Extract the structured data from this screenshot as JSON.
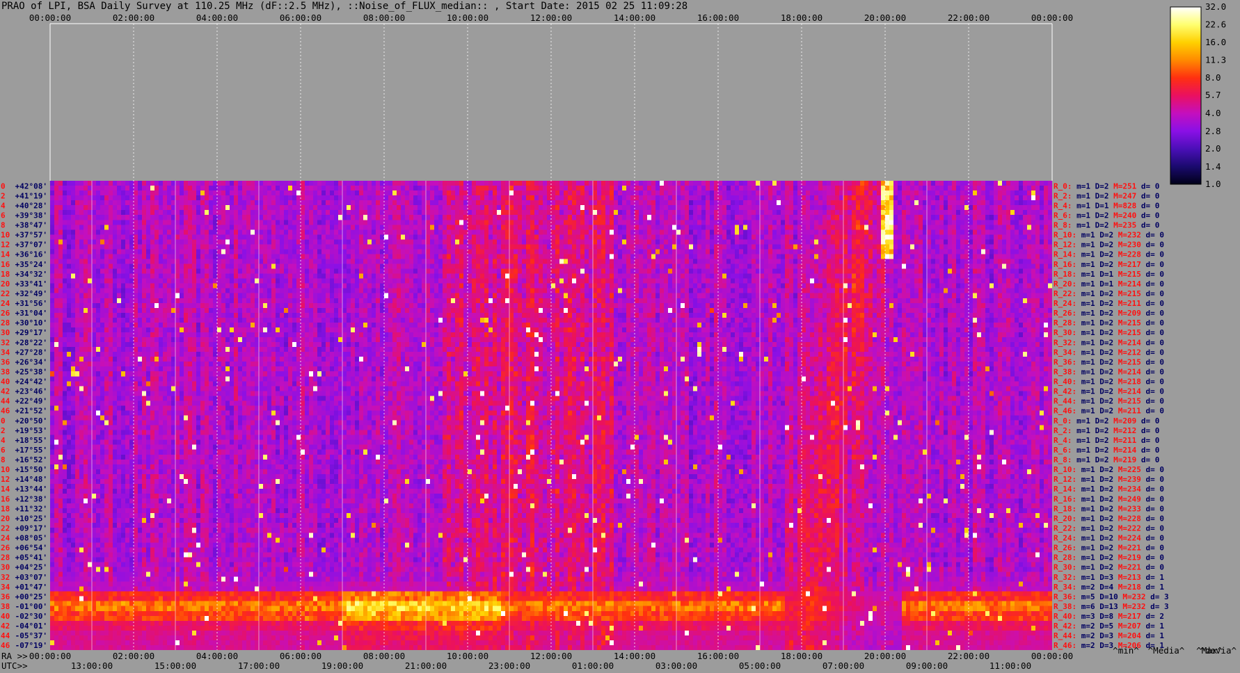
{
  "header": {
    "title": "PRAO of LPI, BSA Daily Survey at 110.25 MHz (dF::2.5 MHz), ::Noise_of_FLUX_median:: , Start Date: 2015 02 25 11:09:28"
  },
  "chart_data": {
    "type": "heatmap",
    "top_axis_ticks": [
      "00:00:00",
      "02:00:00",
      "04:00:00",
      "06:00:00",
      "08:00:00",
      "10:00:00",
      "12:00:00",
      "14:00:00",
      "16:00:00",
      "18:00:00",
      "20:00:00",
      "22:00:00",
      "00:00:00"
    ],
    "ra_axis_prefix": "RA >>",
    "ra_axis_ticks": [
      "00:00:00",
      "02:00:00",
      "04:00:00",
      "06:00:00",
      "08:00:00",
      "10:00:00",
      "12:00:00",
      "14:00:00",
      "16:00:00",
      "18:00:00",
      "20:00:00",
      "22:00:00",
      "00:00:00"
    ],
    "utc_axis_prefix": "UTC>>",
    "utc_axis_ticks": [
      "13:00:00",
      "15:00:00",
      "17:00:00",
      "19:00:00",
      "21:00:00",
      "23:00:00",
      "01:00:00",
      "03:00:00",
      "05:00:00",
      "07:00:00",
      "09:00:00",
      "11:00:00"
    ],
    "colorbar_ticks": [
      "32.0",
      "22.6",
      "16.0",
      "11.3",
      "8.0",
      "5.7",
      "4.0",
      "2.8",
      "2.0",
      "1.4",
      "1.0"
    ],
    "colorbar_scale": "log",
    "colorbar_range": [
      1.0,
      32.0
    ],
    "colormap": [
      "#000018",
      "#1a0a6e",
      "#4b0fb8",
      "#8a10e6",
      "#c40fbe",
      "#ea1060",
      "#ff3010",
      "#ff8a00",
      "#ffd000",
      "#ffff70",
      "#ffffff"
    ],
    "dec_labels": [
      "+42°08'",
      "+41°19'",
      "+40°28'",
      "+39°38'",
      "+38°47'",
      "+37°57'",
      "+37°07'",
      "+36°16'",
      "+35°24'",
      "+34°32'",
      "+33°41'",
      "+32°49'",
      "+31°56'",
      "+31°04'",
      "+30°10'",
      "+29°17'",
      "+28°22'",
      "+27°28'",
      "+26°34'",
      "+25°38'",
      "+24°42'",
      "+23°46'",
      "+22°49'",
      "+21°52'",
      "+20°50'",
      "+19°53'",
      "+18°55'",
      "+17°55'",
      "+16°52'",
      "+15°50'",
      "+14°48'",
      "+13°44'",
      "+12°38'",
      "+11°32'",
      "+10°25'",
      "+09°17'",
      "+08°05'",
      "+06°54'",
      "+05°41'",
      "+04°25'",
      "+03°07'",
      "+01°47'",
      "+00°25'",
      "-01°00'",
      "-02°30'",
      "-04°01'",
      "-05°37'",
      "-07°19'"
    ],
    "beam_index_labels": [
      "0",
      "2",
      "4",
      "6",
      "8",
      "10",
      "12",
      "14",
      "16",
      "18",
      "20",
      "22",
      "24",
      "26",
      "28",
      "30",
      "32",
      "34",
      "36",
      "38",
      "40",
      "42",
      "44",
      "46"
    ],
    "row_stats": [
      {
        "r": "R_0:",
        "m": "m=1",
        "d": "D=2",
        "M": "M=251",
        "dv": "d= 0"
      },
      {
        "r": "R_2:",
        "m": "m=1",
        "d": "D=2",
        "M": "M=247",
        "dv": "d= 0"
      },
      {
        "r": "R_4:",
        "m": "m=1",
        "d": "D=1",
        "M": "M=828",
        "dv": "d= 0"
      },
      {
        "r": "R_6:",
        "m": "m=1",
        "d": "D=2",
        "M": "M=240",
        "dv": "d= 0"
      },
      {
        "r": "R_8:",
        "m": "m=1",
        "d": "D=2",
        "M": "M=235",
        "dv": "d= 0"
      },
      {
        "r": "R_10:",
        "m": "m=1",
        "d": "D=2",
        "M": "M=232",
        "dv": "d= 0"
      },
      {
        "r": "R_12:",
        "m": "m=1",
        "d": "D=2",
        "M": "M=230",
        "dv": "d= 0"
      },
      {
        "r": "R_14:",
        "m": "m=1",
        "d": "D=2",
        "M": "M=228",
        "dv": "d= 0"
      },
      {
        "r": "R_16:",
        "m": "m=1",
        "d": "D=2",
        "M": "M=217",
        "dv": "d= 0"
      },
      {
        "r": "R_18:",
        "m": "m=1",
        "d": "D=1",
        "M": "M=215",
        "dv": "d= 0"
      },
      {
        "r": "R_20:",
        "m": "m=1",
        "d": "D=1",
        "M": "M=214",
        "dv": "d= 0"
      },
      {
        "r": "R_22:",
        "m": "m=1",
        "d": "D=2",
        "M": "M=215",
        "dv": "d= 0"
      },
      {
        "r": "R_24:",
        "m": "m=1",
        "d": "D=2",
        "M": "M=211",
        "dv": "d= 0"
      },
      {
        "r": "R_26:",
        "m": "m=1",
        "d": "D=2",
        "M": "M=209",
        "dv": "d= 0"
      },
      {
        "r": "R_28:",
        "m": "m=1",
        "d": "D=2",
        "M": "M=215",
        "dv": "d= 0"
      },
      {
        "r": "R_30:",
        "m": "m=1",
        "d": "D=2",
        "M": "M=215",
        "dv": "d= 0"
      },
      {
        "r": "R_32:",
        "m": "m=1",
        "d": "D=2",
        "M": "M=214",
        "dv": "d= 0"
      },
      {
        "r": "R_34:",
        "m": "m=1",
        "d": "D=2",
        "M": "M=212",
        "dv": "d= 0"
      },
      {
        "r": "R_36:",
        "m": "m=1",
        "d": "D=2",
        "M": "M=215",
        "dv": "d= 0"
      },
      {
        "r": "R_38:",
        "m": "m=1",
        "d": "D=2",
        "M": "M=214",
        "dv": "d= 0"
      },
      {
        "r": "R_40:",
        "m": "m=1",
        "d": "D=2",
        "M": "M=218",
        "dv": "d= 0"
      },
      {
        "r": "R_42:",
        "m": "m=1",
        "d": "D=2",
        "M": "M=214",
        "dv": "d= 0"
      },
      {
        "r": "R_44:",
        "m": "m=1",
        "d": "D=2",
        "M": "M=215",
        "dv": "d= 0"
      },
      {
        "r": "R_46:",
        "m": "m=1",
        "d": "D=2",
        "M": "M=211",
        "dv": "d= 0"
      },
      {
        "r": "R_0:",
        "m": "m=1",
        "d": "D=2",
        "M": "M=209",
        "dv": "d= 0"
      },
      {
        "r": "R_2:",
        "m": "m=1",
        "d": "D=2",
        "M": "M=212",
        "dv": "d= 0"
      },
      {
        "r": "R_4:",
        "m": "m=1",
        "d": "D=2",
        "M": "M=211",
        "dv": "d= 0"
      },
      {
        "r": "R_6:",
        "m": "m=1",
        "d": "D=2",
        "M": "M=214",
        "dv": "d= 0"
      },
      {
        "r": "R_8:",
        "m": "m=1",
        "d": "D=2",
        "M": "M=219",
        "dv": "d= 0"
      },
      {
        "r": "R_10:",
        "m": "m=1",
        "d": "D=2",
        "M": "M=225",
        "dv": "d= 0"
      },
      {
        "r": "R_12:",
        "m": "m=1",
        "d": "D=2",
        "M": "M=239",
        "dv": "d= 0"
      },
      {
        "r": "R_14:",
        "m": "m=1",
        "d": "D=2",
        "M": "M=234",
        "dv": "d= 0"
      },
      {
        "r": "R_16:",
        "m": "m=1",
        "d": "D=2",
        "M": "M=249",
        "dv": "d= 0"
      },
      {
        "r": "R_18:",
        "m": "m=1",
        "d": "D=2",
        "M": "M=233",
        "dv": "d= 0"
      },
      {
        "r": "R_20:",
        "m": "m=1",
        "d": "D=2",
        "M": "M=228",
        "dv": "d= 0"
      },
      {
        "r": "R_22:",
        "m": "m=1",
        "d": "D=2",
        "M": "M=222",
        "dv": "d= 0"
      },
      {
        "r": "R_24:",
        "m": "m=1",
        "d": "D=2",
        "M": "M=224",
        "dv": "d= 0"
      },
      {
        "r": "R_26:",
        "m": "m=1",
        "d": "D=2",
        "M": "M=221",
        "dv": "d= 0"
      },
      {
        "r": "R_28:",
        "m": "m=1",
        "d": "D=2",
        "M": "M=219",
        "dv": "d= 0"
      },
      {
        "r": "R_30:",
        "m": "m=1",
        "d": "D=2",
        "M": "M=221",
        "dv": "d= 0"
      },
      {
        "r": "R_32:",
        "m": "m=1",
        "d": "D=3",
        "M": "M=213",
        "dv": "d= 1"
      },
      {
        "r": "R_34:",
        "m": "m=2",
        "d": "D=4",
        "M": "M=218",
        "dv": "d= 1"
      },
      {
        "r": "R_36:",
        "m": "m=5",
        "d": "D=10",
        "M": "M=232",
        "dv": "d= 3"
      },
      {
        "r": "R_38:",
        "m": "m=6",
        "d": "D=13",
        "M": "M=232",
        "dv": "d= 3"
      },
      {
        "r": "R_40:",
        "m": "m=3",
        "d": "D=8",
        "M": "M=217",
        "dv": "d= 2"
      },
      {
        "r": "R_42:",
        "m": "m=2",
        "d": "D=5",
        "M": "M=207",
        "dv": "d= 1"
      },
      {
        "r": "R_44:",
        "m": "m=2",
        "d": "D=3",
        "M": "M=204",
        "dv": "d= 1"
      },
      {
        "r": "R_46:",
        "m": "m=2",
        "d": "D=3",
        "M": "M=206",
        "dv": "d= 1"
      }
    ],
    "stat_legend": {
      "min": "^min^",
      "median": "^Media^",
      "max": "^Max^",
      "devia": "^devia^"
    },
    "colors": {
      "label_red": "#ff1010",
      "label_navy": "#000060",
      "background": "#9c9c9c"
    }
  }
}
